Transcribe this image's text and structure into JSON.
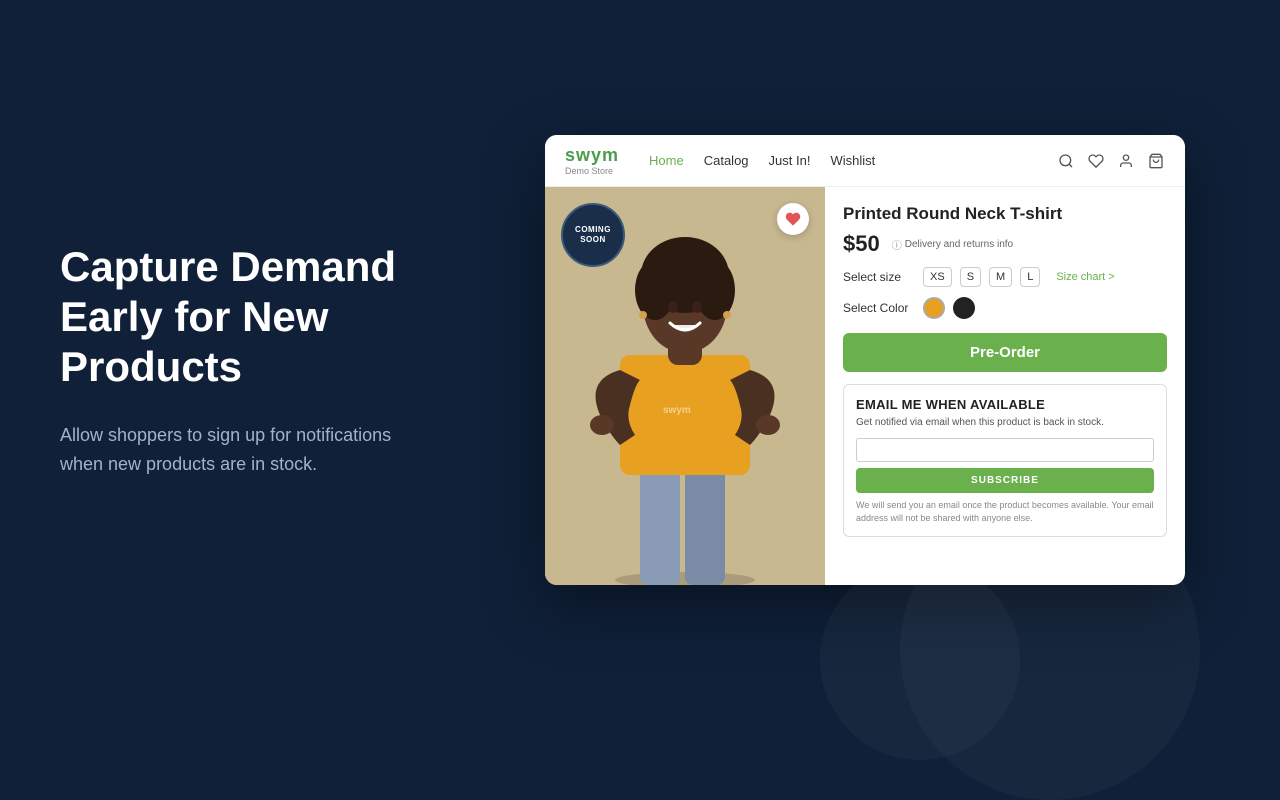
{
  "background": {
    "color": "#0f2038"
  },
  "left": {
    "heading": "Capture Demand Early for New Products",
    "description": "Allow shoppers to sign up for notifications when new products are in stock."
  },
  "navbar": {
    "brand_name": "swym",
    "brand_sub": "Demo Store",
    "links": [
      {
        "label": "Home",
        "active": true
      },
      {
        "label": "Catalog",
        "active": false
      },
      {
        "label": "Just In!",
        "active": false
      },
      {
        "label": "Wishlist",
        "active": false
      }
    ],
    "icons": [
      "search",
      "heart",
      "user",
      "cart"
    ]
  },
  "product": {
    "title": "Printed Round Neck T-shirt",
    "price": "$50",
    "delivery_text": "Delivery and returns info",
    "coming_soon_line1": "COMING",
    "coming_soon_line2": "SOON",
    "size_label": "Select size",
    "sizes": [
      "XS",
      "S",
      "M",
      "L"
    ],
    "size_chart_label": "Size chart >",
    "color_label": "Select Color",
    "colors": [
      {
        "name": "orange",
        "hex": "#e8a020",
        "selected": true
      },
      {
        "name": "black",
        "hex": "#222222",
        "selected": false
      }
    ],
    "preorder_label": "Pre-Order",
    "email_section": {
      "title": "EMAIL ME WHEN AVAILABLE",
      "description": "Get notified via email when this product is back in stock.",
      "input_placeholder": "",
      "subscribe_label": "SUBSCRIBE",
      "disclaimer": "We will send you an email once the product becomes available. Your email address will not be shared with anyone else."
    }
  }
}
